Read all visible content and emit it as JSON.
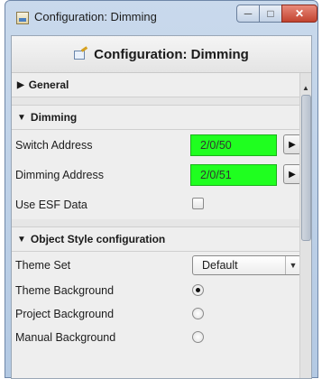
{
  "window": {
    "title": "Configuration: Dimming",
    "controls": {
      "minimize": "─",
      "maximize": "□",
      "close": "✕"
    }
  },
  "header": {
    "title": "Configuration: Dimming"
  },
  "sections": {
    "general": {
      "label": "General",
      "expanded": false
    },
    "dimming": {
      "label": "Dimming",
      "expanded": true,
      "switch_address": {
        "label": "Switch Address",
        "value": "2/0/50"
      },
      "dimming_address": {
        "label": "Dimming Address",
        "value": "2/0/51"
      },
      "use_esf": {
        "label": "Use ESF Data",
        "checked": false
      }
    },
    "object_style": {
      "label": "Object Style configuration",
      "expanded": true,
      "theme_set": {
        "label": "Theme Set",
        "value": "Default"
      },
      "backgrounds": [
        {
          "label": "Theme Background",
          "checked": true
        },
        {
          "label": "Project Background",
          "checked": false
        },
        {
          "label": "Manual Background",
          "checked": false
        }
      ]
    }
  },
  "colors": {
    "address_field_bg": "#1fff1f",
    "titlebar": "#c9d9ec",
    "close_button": "#c24330"
  },
  "icons": [
    "app-icon",
    "edit-config-icon",
    "expand-triangle-icon",
    "collapse-triangle-icon",
    "arrow-right-icon",
    "dropdown-icon"
  ]
}
